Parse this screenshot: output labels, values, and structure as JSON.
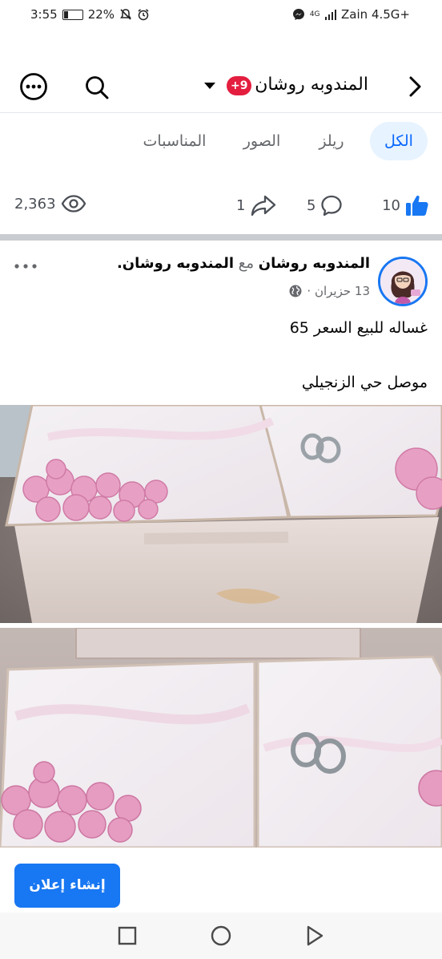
{
  "status_bar": {
    "time": "3:55",
    "battery_percent": "22%",
    "battery_level": 0.22,
    "carrier": "Zain 4.5G+",
    "network_type": "4G"
  },
  "header": {
    "page_name": "المندوبه روشان",
    "notification_count": "+9"
  },
  "tabs": [
    {
      "label": "الكل",
      "active": true
    },
    {
      "label": "ريلز",
      "active": false
    },
    {
      "label": "الصور",
      "active": false
    },
    {
      "label": "المناسبات",
      "active": false
    }
  ],
  "stats": {
    "likes": "10",
    "comments": "5",
    "shares": "1",
    "views": "2,363"
  },
  "post": {
    "author": "المندوبه روشان",
    "with_word": "مع",
    "tagged": "المندوبه روشان.",
    "date": "13 حزيران ·",
    "line1": "غساله للبيع السعر 65",
    "line2": "موصل حي الزنجيلي"
  },
  "create_ad_label": "إنشاء إعلان",
  "colors": {
    "accent": "#1877f2",
    "badge": "#e41e3f",
    "tab_active_bg": "#e7f3ff"
  },
  "icons": {
    "back": "chevron-right-icon",
    "search": "search-icon",
    "more": "more-circle-icon",
    "like": "thumbs-up-icon",
    "comment": "comment-bubble-icon",
    "share": "share-arrow-icon",
    "views": "eye-icon"
  }
}
